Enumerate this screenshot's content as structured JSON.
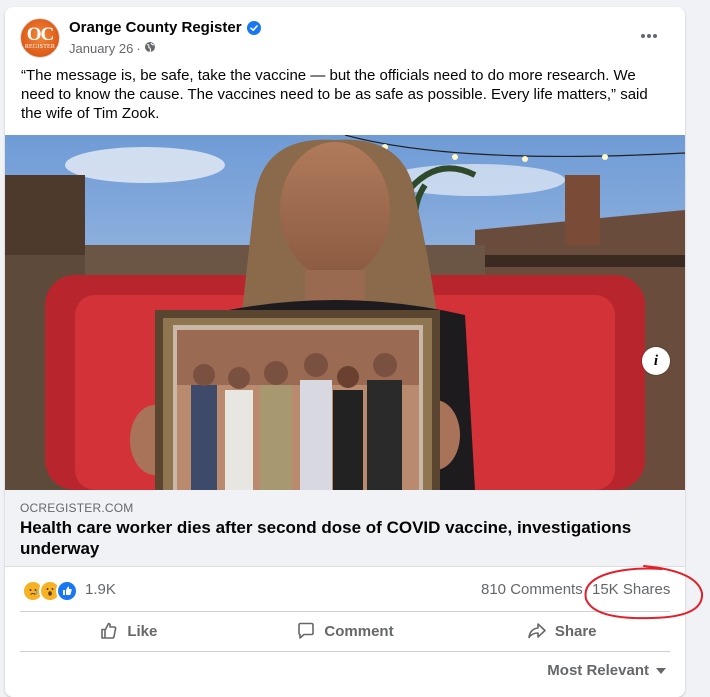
{
  "post": {
    "avatar": {
      "big": "OC",
      "small": "REGISTER"
    },
    "page_name": "Orange County Register",
    "date": "January 26",
    "separator": "·",
    "text": "“The message is, be safe, take the vaccine — but the officials need to do more research. We need to know the cause. The vaccines need to be as safe as possible. Every life matters,” said the wife of Tim Zook."
  },
  "link": {
    "domain": "OCREGISTER.COM",
    "headline": "Health care worker dies after second dose of COVID vaccine, investigations underway",
    "info_label": "i"
  },
  "stats": {
    "reaction_count": "1.9K",
    "comments": "810 Comments",
    "shares": "15K Shares"
  },
  "actions": {
    "like": "Like",
    "comment": "Comment",
    "share": "Share"
  },
  "sort": {
    "label": "Most Relevant"
  },
  "colors": {
    "facebook_blue": "#1877f2",
    "secondary_text": "#65676b",
    "annotation_red": "#e0202a"
  }
}
